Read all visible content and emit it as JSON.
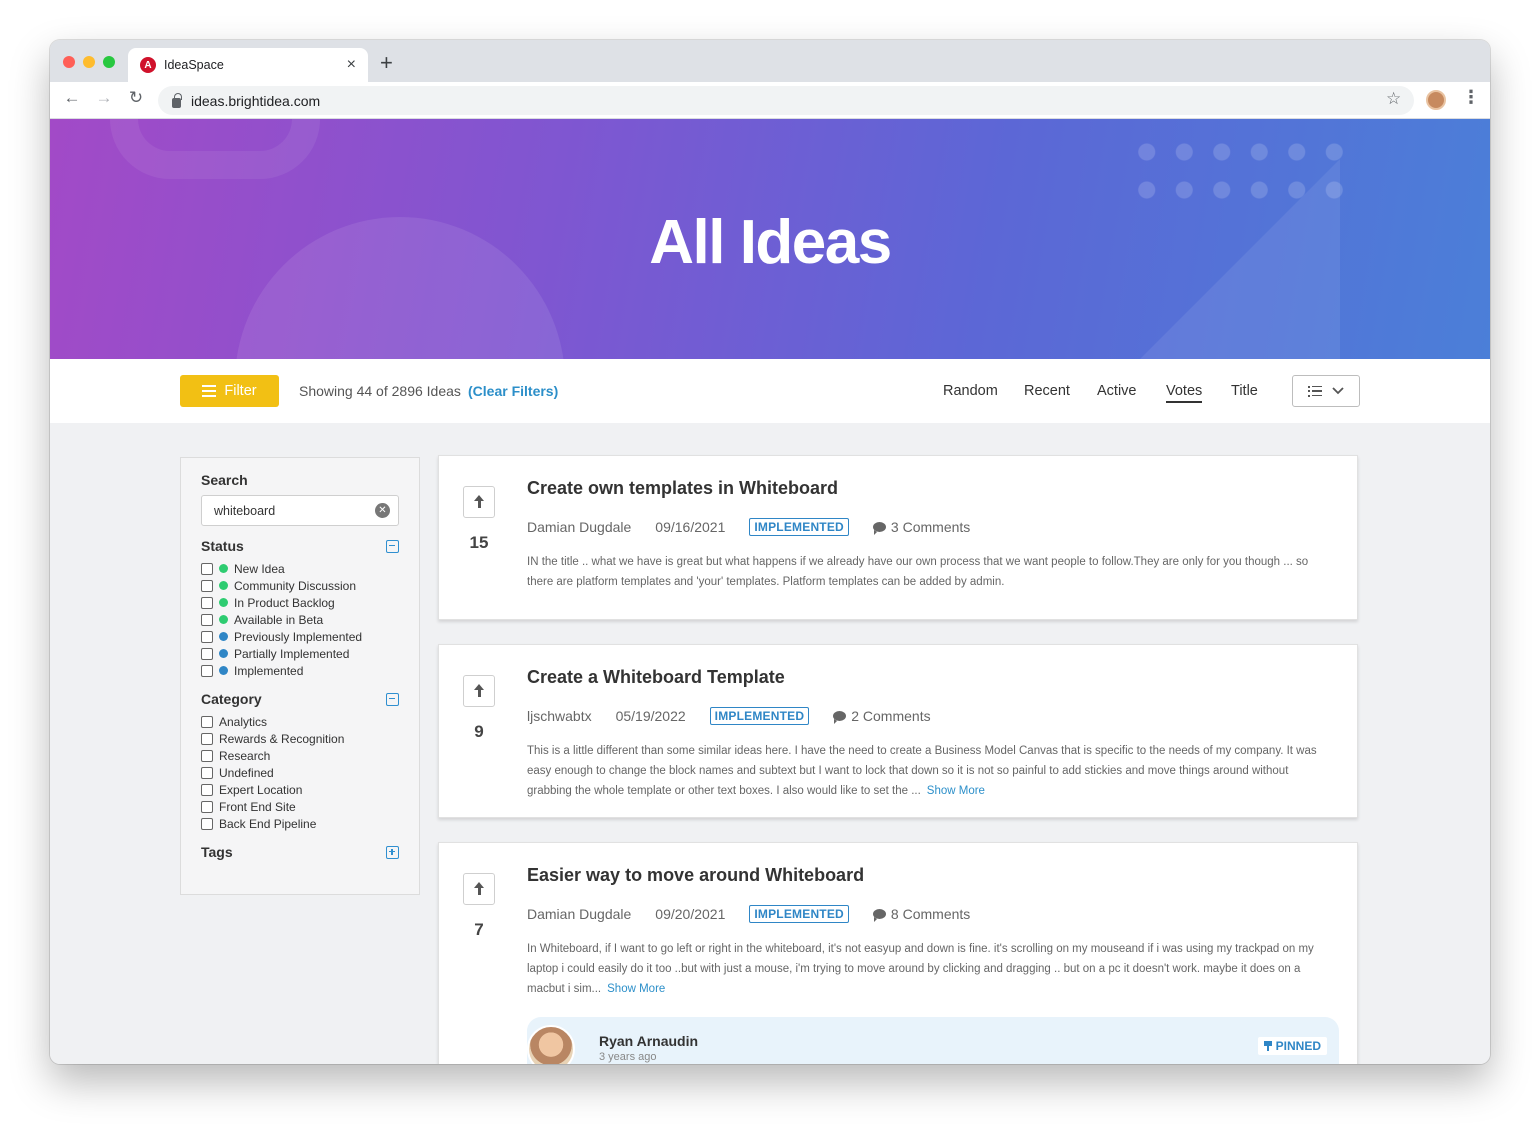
{
  "browser": {
    "tab_title": "IdeaSpace",
    "favicon_letter": "A",
    "url": "ideas.brightidea.com",
    "close_glyph": "×",
    "newtab_glyph": "+",
    "back_glyph": "←",
    "forward_glyph": "→",
    "reload_glyph": "↻",
    "star_glyph": "☆",
    "menu_glyph": "⋮"
  },
  "hero": {
    "title": "All Ideas"
  },
  "filterbar": {
    "filter_label": "Filter",
    "showing_text": "Showing 44 of 2896 Ideas",
    "clear_filters": "(Clear Filters)",
    "sort_options": [
      "Random",
      "Recent",
      "Active",
      "Votes",
      "Title"
    ],
    "active_sort": "Votes"
  },
  "sidebar": {
    "search_label": "Search",
    "search_value": "whiteboard",
    "status_label": "Status",
    "statuses": [
      {
        "label": "New Idea",
        "color": "#2ecc71"
      },
      {
        "label": "Community Discussion",
        "color": "#2ecc71"
      },
      {
        "label": "In Product Backlog",
        "color": "#2ecc71"
      },
      {
        "label": "Available in Beta",
        "color": "#2ecc71"
      },
      {
        "label": "Previously Implemented",
        "color": "#2f86c6"
      },
      {
        "label": "Partially Implemented",
        "color": "#2f86c6"
      },
      {
        "label": "Implemented",
        "color": "#2f86c6"
      }
    ],
    "category_label": "Category",
    "categories": [
      "Analytics",
      "Rewards & Recognition",
      "Research",
      "Undefined",
      "Expert Location",
      "Front End Site",
      "Back End Pipeline"
    ],
    "tags_label": "Tags"
  },
  "ideas": [
    {
      "votes": "15",
      "title": "Create own templates in Whiteboard",
      "author": "Damian Dugdale",
      "date": "09/16/2021",
      "status": "IMPLEMENTED",
      "comments": "3 Comments",
      "description": "IN the title .. what we have is great but what happens if we already have our own process that we want people to follow.They are only for you though ... so there are platform templates and 'your' templates. Platform templates can be added by admin."
    },
    {
      "votes": "9",
      "title": "Create a Whiteboard Template",
      "author": "ljschwabtx",
      "date": "05/19/2022",
      "status": "IMPLEMENTED",
      "comments": "2 Comments",
      "description": "This is a little different than some similar ideas here.  I have the need to create a Business Model Canvas that is specific to the needs of my company. It was easy enough to change the block names and subtext but I want to lock that down so it is not so painful to add stickies and move things around without grabbing the whole template or other text boxes. I also would like to set the ...",
      "show_more": "Show More"
    },
    {
      "votes": "7",
      "title": "Easier way to move around Whiteboard",
      "author": "Damian Dugdale",
      "date": "09/20/2021",
      "status": "IMPLEMENTED",
      "comments": "8 Comments",
      "description": "In Whiteboard, if I want to go left or right in the whiteboard, it's not easyup and down is fine. it's scrolling on my mouseand if i was using my trackpad on my laptop i could easily do it too ..but with just a mouse, i'm trying to move around by clicking and dragging .. but on a pc it doesn't work. maybe it does on a macbut i sim...",
      "show_more": "Show More",
      "pinned_comment": {
        "name": "Ryan Arnaudin",
        "time": "3 years ago",
        "badge": "PINNED"
      }
    }
  ]
}
